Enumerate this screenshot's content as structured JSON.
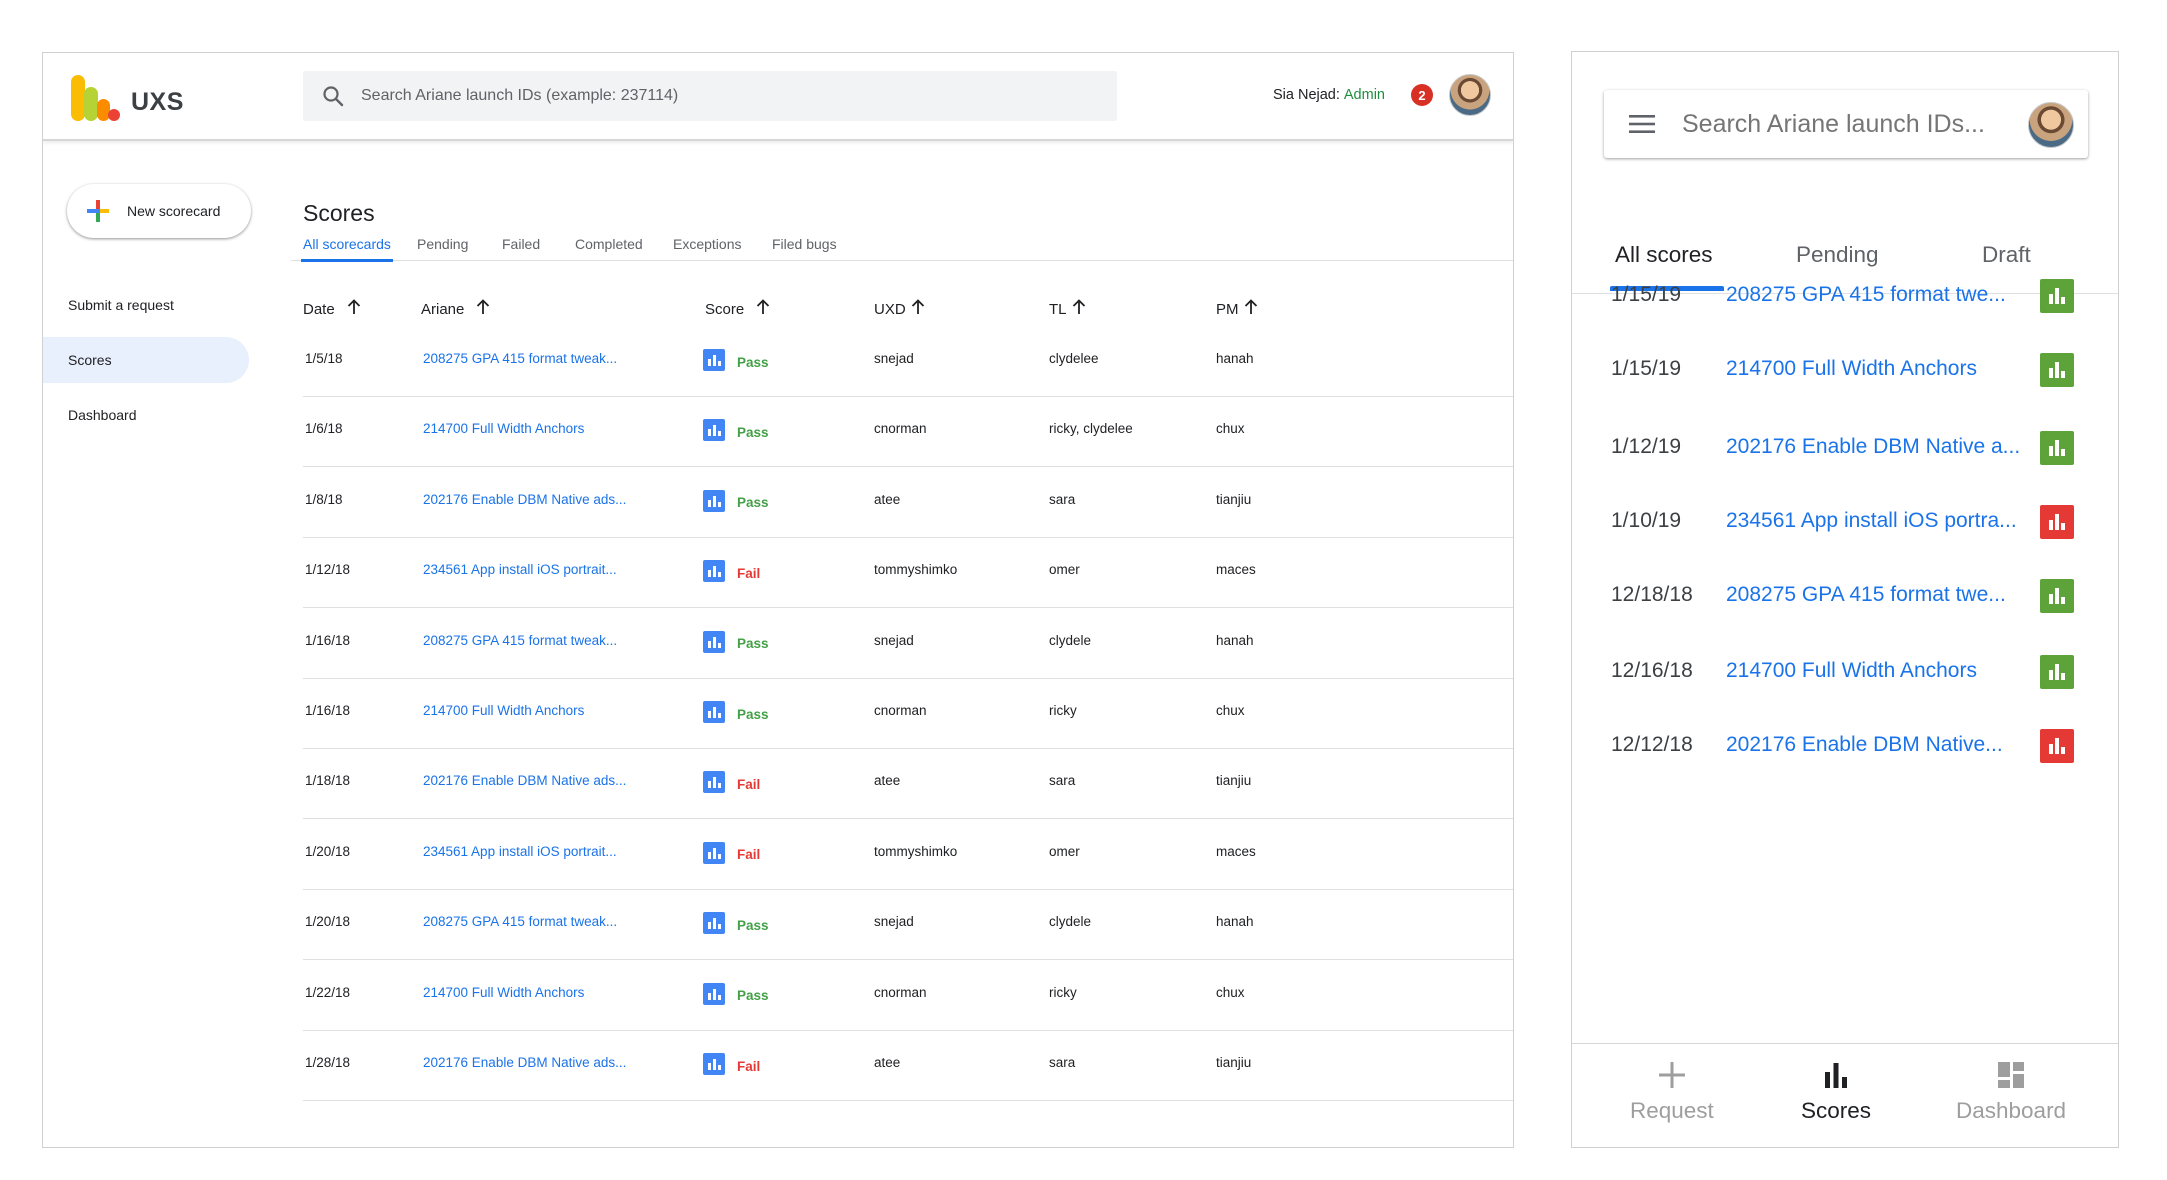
{
  "desktop": {
    "logo_text": "UXS",
    "search_placeholder": "Search Ariane launch IDs (example: 237114)",
    "user": {
      "name": "Sia Nejad:",
      "role": "Admin",
      "notifications": "2"
    },
    "new_button": "New scorecard",
    "nav": [
      {
        "label": "Submit a request"
      },
      {
        "label": "Scores"
      },
      {
        "label": "Dashboard"
      }
    ],
    "page_title": "Scores",
    "tabs": [
      "All scorecards",
      "Pending",
      "Failed",
      "Completed",
      "Exceptions",
      "Filed bugs"
    ],
    "columns": [
      "Date",
      "Ariane",
      "Score",
      "UXD",
      "TL",
      "PM"
    ],
    "rows": [
      {
        "date": "1/5/18",
        "ariane": "208275 GPA 415 format tweak...",
        "score": "Pass",
        "uxd": "snejad",
        "tl": "clydelee",
        "pm": "hanah"
      },
      {
        "date": "1/6/18",
        "ariane": "214700 Full Width Anchors",
        "score": "Pass",
        "uxd": "cnorman",
        "tl": "ricky, clydelee",
        "pm": "chux"
      },
      {
        "date": "1/8/18",
        "ariane": "202176 Enable DBM Native ads...",
        "score": "Pass",
        "uxd": "atee",
        "tl": "sara",
        "pm": "tianjiu"
      },
      {
        "date": "1/12/18",
        "ariane": "234561 App install iOS portrait...",
        "score": "Fail",
        "uxd": "tommyshimko",
        "tl": "omer",
        "pm": "maces"
      },
      {
        "date": "1/16/18",
        "ariane": "208275 GPA 415 format tweak...",
        "score": "Pass",
        "uxd": "snejad",
        "tl": "clydele",
        "pm": "hanah"
      },
      {
        "date": "1/16/18",
        "ariane": "214700 Full Width Anchors",
        "score": "Pass",
        "uxd": "cnorman",
        "tl": "ricky",
        "pm": "chux"
      },
      {
        "date": "1/18/18",
        "ariane": "202176 Enable DBM Native ads...",
        "score": "Fail",
        "uxd": "atee",
        "tl": "sara",
        "pm": "tianjiu"
      },
      {
        "date": "1/20/18",
        "ariane": "234561 App install iOS portrait...",
        "score": "Fail",
        "uxd": "tommyshimko",
        "tl": "omer",
        "pm": "maces"
      },
      {
        "date": "1/20/18",
        "ariane": "208275 GPA 415 format tweak...",
        "score": "Pass",
        "uxd": "snejad",
        "tl": "clydele",
        "pm": "hanah"
      },
      {
        "date": "1/22/18",
        "ariane": "214700 Full Width Anchors",
        "score": "Pass",
        "uxd": "cnorman",
        "tl": "ricky",
        "pm": "chux"
      },
      {
        "date": "1/28/18",
        "ariane": "202176 Enable DBM Native ads...",
        "score": "Fail",
        "uxd": "atee",
        "tl": "sara",
        "pm": "tianjiu"
      }
    ]
  },
  "mobile": {
    "search_placeholder": "Search Ariane launch IDs...",
    "tabs": [
      "All scores",
      "Pending",
      "Draft"
    ],
    "rows": [
      {
        "date": "1/15/19",
        "title": "208275 GPA 415 format twe...",
        "score": "pass"
      },
      {
        "date": "1/15/19",
        "title": "214700 Full Width Anchors",
        "score": "pass"
      },
      {
        "date": "1/12/19",
        "title": "202176 Enable DBM Native a...",
        "score": "pass"
      },
      {
        "date": "1/10/19",
        "title": "234561 App install iOS portra...",
        "score": "fail"
      },
      {
        "date": "12/18/18",
        "title": "208275 GPA 415 format twe...",
        "score": "pass"
      },
      {
        "date": "12/16/18",
        "title": "214700 Full Width Anchors",
        "score": "pass"
      },
      {
        "date": "12/12/18",
        "title": "202176 Enable DBM Native...",
        "score": "fail"
      }
    ],
    "bottom_nav": [
      "Request",
      "Scores",
      "Dashboard"
    ]
  },
  "colors": {
    "accent": "#1a73e8",
    "pass": "#43a047",
    "fail": "#e53935",
    "active_nav_bg": "#e8f0fe"
  },
  "icons": {
    "search": "search-icon",
    "menu": "menu-icon",
    "sort": "arrow-up-icon",
    "score": "bar-chart-icon"
  }
}
